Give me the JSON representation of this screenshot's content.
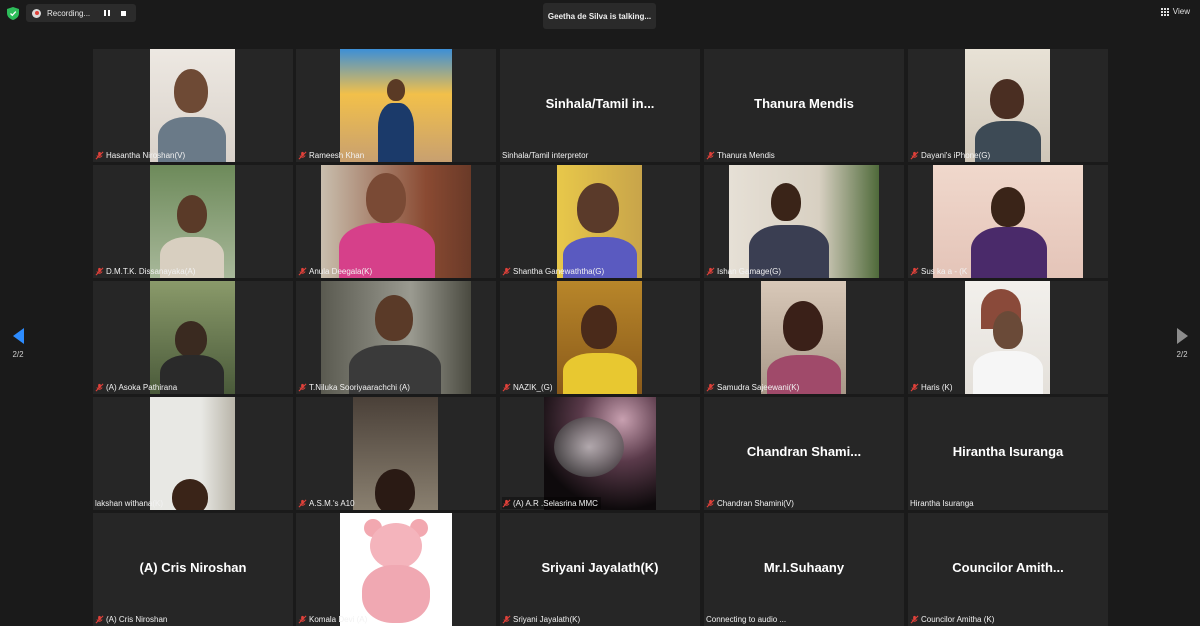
{
  "top_bar": {
    "recording_label": "Recording...",
    "talking_text": "Geetha de Silva is talking...",
    "view_label": "View"
  },
  "pagination": {
    "left_page": "2/2",
    "right_page": "2/2"
  },
  "participants": [
    {
      "label": "Hasantha Niroshan(V)",
      "muted": true
    },
    {
      "label": "Rameesh Khan",
      "muted": true
    },
    {
      "label": "Sinhala/Tamil interpretor",
      "title": "Sinhala/Tamil  in...",
      "muted": false
    },
    {
      "label": "Thanura Mendis",
      "title": "Thanura Mendis",
      "muted": true
    },
    {
      "label": "Dayani's iPhone(G)",
      "muted": true
    },
    {
      "label": "D.M.T.K. Dissanayaka(A)",
      "muted": true
    },
    {
      "label": "Anula Deegala(K)",
      "muted": true
    },
    {
      "label": "Shantha Ganewaththa(G)",
      "muted": true
    },
    {
      "label": "Ishan Gamage(G)",
      "muted": true
    },
    {
      "label": "Sus ka a - (K",
      "muted": true
    },
    {
      "label": "(A) Asoka Pathirana",
      "muted": true
    },
    {
      "label": "T.Niluka Sooriyaarachchi (A)",
      "muted": true
    },
    {
      "label": "NAZIK_(G)",
      "muted": true
    },
    {
      "label": "Samudra Sajeewani(K)",
      "muted": true
    },
    {
      "label": "Haris (K)",
      "muted": true
    },
    {
      "label": "lakshan withana(K)",
      "muted": false
    },
    {
      "label": "A.S.M.'s A10",
      "muted": true
    },
    {
      "label": "(A) A.R .Selasrina MMC",
      "muted": true
    },
    {
      "label": "Chandran Shamini(V)",
      "title": "Chandran  Shami...",
      "muted": true
    },
    {
      "label": "Hirantha Isuranga",
      "title": "Hirantha Isuranga",
      "muted": false
    },
    {
      "label": "(A) Cris Niroshan",
      "title": "(A) Cris Niroshan",
      "muted": true
    },
    {
      "label": "Komala Devi (A)",
      "muted": true
    },
    {
      "label": "Sriyani Jayalath(K)",
      "title": "Sriyani Jayalath(K)",
      "muted": true
    },
    {
      "label": "Connecting to audio ...",
      "title": "Mr.I.Suhaany",
      "muted": false
    },
    {
      "label": "Councilor Amitha (K)",
      "title": "Councilor  Amith...",
      "muted": true
    }
  ],
  "colors": {
    "background": "#1a1a1a",
    "tile": "#262626",
    "accent_blue": "#2d8cff",
    "muted_red": "#e0413a"
  }
}
